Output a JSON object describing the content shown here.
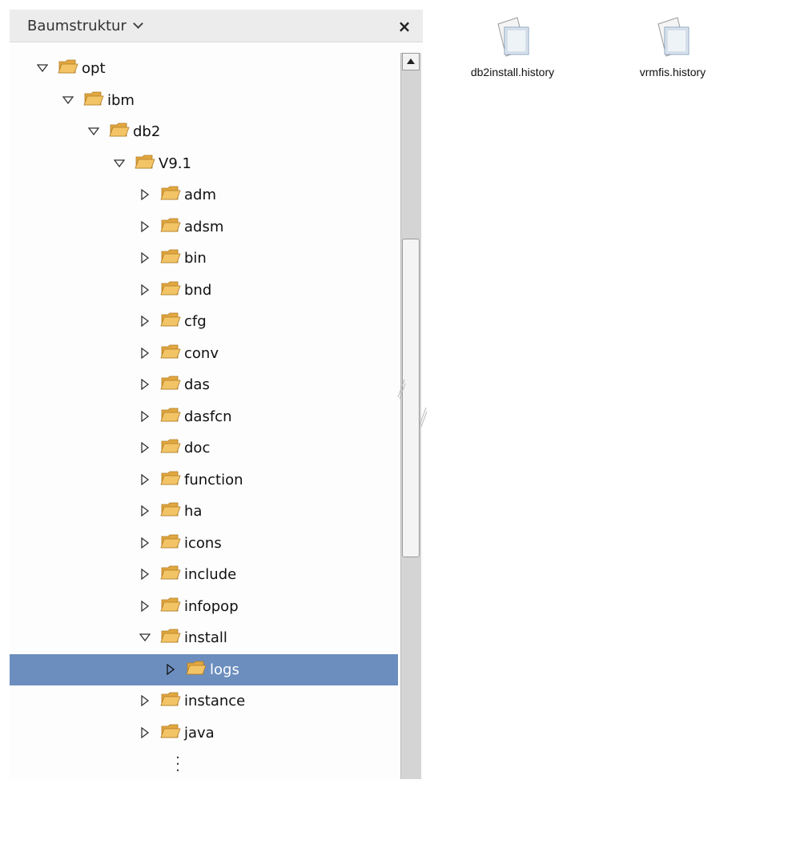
{
  "panel": {
    "title": "Baumstruktur",
    "close_label": "×"
  },
  "tree": [
    {
      "label": "opt",
      "expanded": true
    },
    {
      "label": "ibm",
      "expanded": true
    },
    {
      "label": "db2",
      "expanded": true
    },
    {
      "label": "V9.1",
      "expanded": true
    },
    {
      "label": "adm",
      "expanded": false
    },
    {
      "label": "adsm",
      "expanded": false
    },
    {
      "label": "bin",
      "expanded": false
    },
    {
      "label": "bnd",
      "expanded": false
    },
    {
      "label": "cfg",
      "expanded": false
    },
    {
      "label": "conv",
      "expanded": false
    },
    {
      "label": "das",
      "expanded": false
    },
    {
      "label": "dasfcn",
      "expanded": false
    },
    {
      "label": "doc",
      "expanded": false
    },
    {
      "label": "function",
      "expanded": false
    },
    {
      "label": "ha",
      "expanded": false
    },
    {
      "label": "icons",
      "expanded": false
    },
    {
      "label": "include",
      "expanded": false
    },
    {
      "label": "infopop",
      "expanded": false
    },
    {
      "label": "install",
      "expanded": true
    },
    {
      "label": "logs",
      "expanded": false,
      "selected": true
    },
    {
      "label": "instance",
      "expanded": false
    },
    {
      "label": "java",
      "expanded": false
    }
  ],
  "files": [
    {
      "label": "db2install.history",
      "icon": "document-icon"
    },
    {
      "label": "vrmfis.history",
      "icon": "document-icon"
    }
  ],
  "colors": {
    "selection": "#6c8ebf",
    "folder": "#f2c466"
  }
}
